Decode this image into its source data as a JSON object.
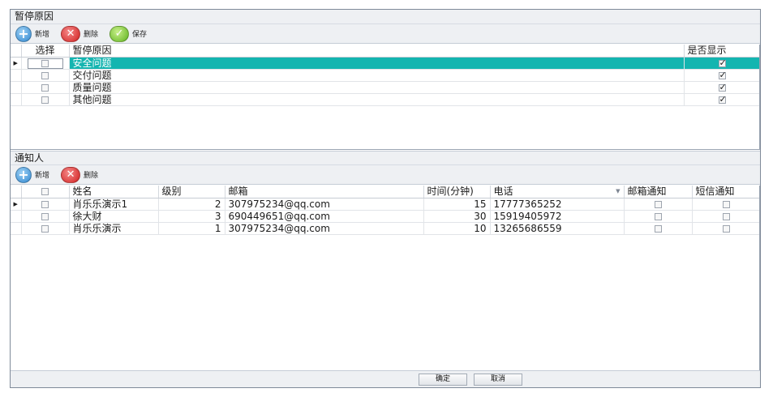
{
  "pause_reasons": {
    "section_title": "暂停原因",
    "toolbar": {
      "add_label": "新增",
      "delete_label": "删除",
      "save_label": "保存"
    },
    "columns": {
      "select": "选择",
      "reason": "暂停原因",
      "show": "是否显示"
    },
    "rows": [
      {
        "selected": false,
        "reason": "安全问题",
        "show": true,
        "current": true
      },
      {
        "selected": false,
        "reason": "交付问题",
        "show": true,
        "current": false
      },
      {
        "selected": false,
        "reason": "质量问题",
        "show": true,
        "current": false
      },
      {
        "selected": false,
        "reason": "其他问题",
        "show": true,
        "current": false
      }
    ]
  },
  "notifiers": {
    "section_title": "通知人",
    "toolbar": {
      "add_label": "新增",
      "delete_label": "删除"
    },
    "columns": {
      "name": "姓名",
      "level": "级别",
      "email": "邮箱",
      "time": "时间(分钟)",
      "phone": "电话",
      "email_notify": "邮箱通知",
      "sms_notify": "短信通知"
    },
    "rows": [
      {
        "name": "肖乐乐演示1",
        "level": "2",
        "email": "307975234@qq.com",
        "time": "15",
        "phone": "17777365252",
        "email_notify": false,
        "sms_notify": false,
        "current": true
      },
      {
        "name": "徐大财",
        "level": "3",
        "email": "690449651@qq.com",
        "time": "30",
        "phone": "15919405972",
        "email_notify": false,
        "sms_notify": false,
        "current": false
      },
      {
        "name": "肖乐乐演示",
        "level": "1",
        "email": "307975234@qq.com",
        "time": "10",
        "phone": "13265686559",
        "email_notify": false,
        "sms_notify": false,
        "current": false
      }
    ]
  },
  "footer": {
    "confirm_label": "确定",
    "cancel_label": "取消"
  },
  "colors": {
    "selection": "#14b5b0",
    "panel": "#eef0f3",
    "border": "#7f8a99"
  },
  "icons": {
    "add": "plus-circle-icon",
    "delete": "x-circle-icon",
    "save": "check-circle-icon",
    "row_indicator": "triangle-right-icon",
    "filter": "filter-icon"
  }
}
